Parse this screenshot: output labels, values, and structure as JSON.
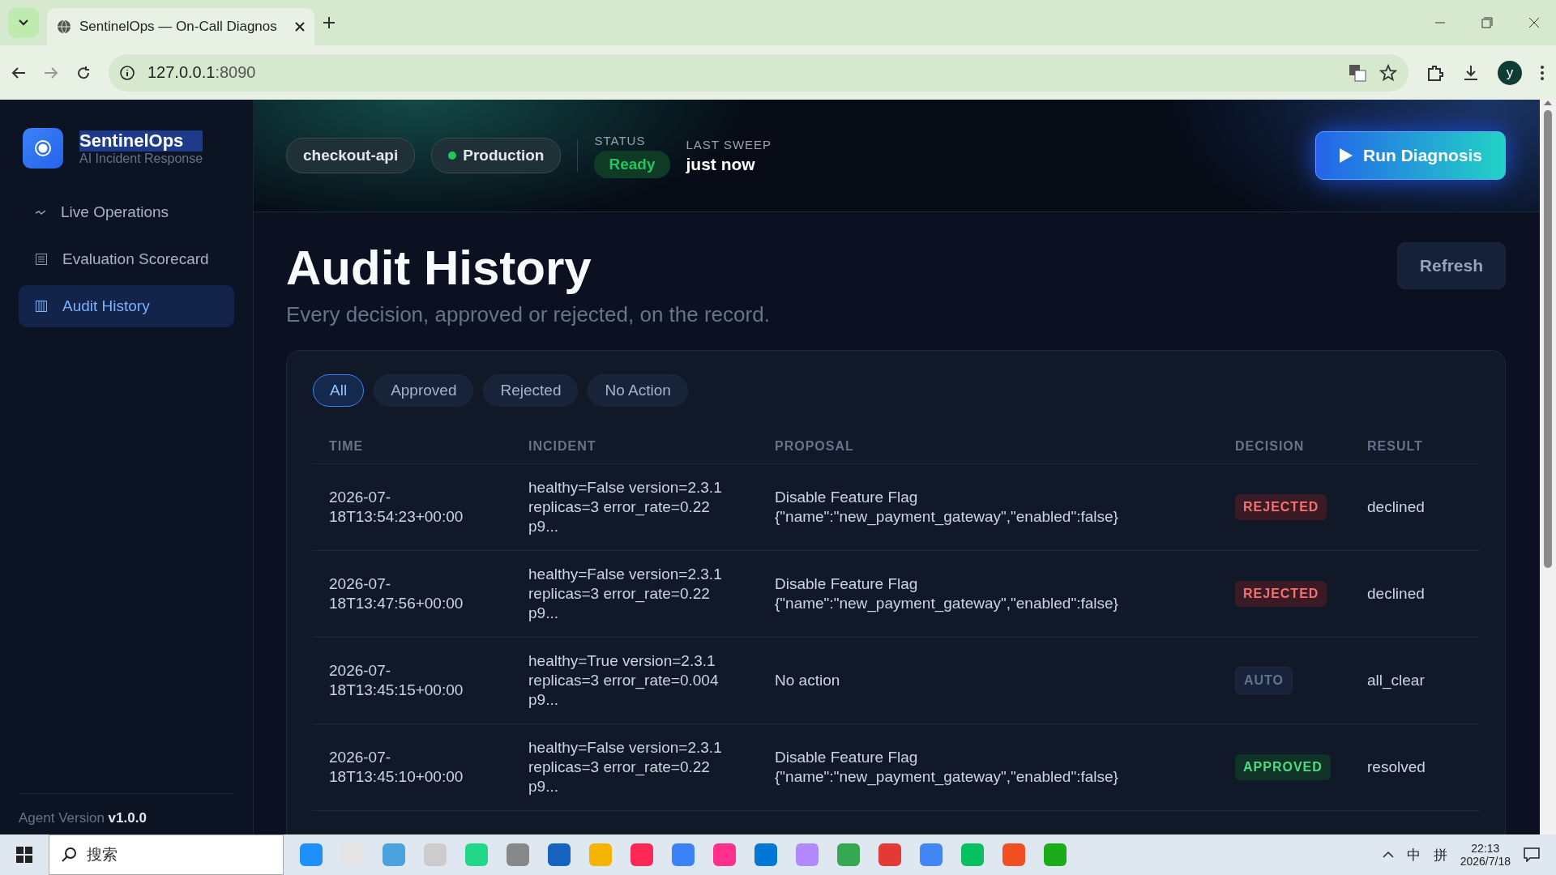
{
  "browser": {
    "tab_title": "SentinelOps — On-Call Diagnos",
    "url_host": "127.0.0.1",
    "url_port": ":8090",
    "profile": "y"
  },
  "sidebar": {
    "brand": "SentinelOps",
    "tagline": "AI Incident Response",
    "items": [
      {
        "label": "Live Operations",
        "kind": "pulse",
        "selected": false
      },
      {
        "label": "Evaluation Scorecard",
        "kind": "list",
        "selected": false
      },
      {
        "label": "Audit History",
        "kind": "columns",
        "selected": true
      }
    ],
    "footer_label": "Agent Version",
    "footer_version": "v1.0.0"
  },
  "header": {
    "service": "checkout-api",
    "environment": {
      "label": "Production",
      "color": "#22c55e"
    },
    "status_label": "STATUS",
    "status": "Ready",
    "sweep_label": "LAST SWEEP",
    "sweep": "just now",
    "run_button": "Run Diagnosis"
  },
  "page": {
    "title": "Audit History",
    "subtitle": "Every decision, approved or rejected, on the record.",
    "refresh": "Refresh"
  },
  "filters": [
    {
      "label": "All",
      "selected": true
    },
    {
      "label": "Approved",
      "selected": false
    },
    {
      "label": "Rejected",
      "selected": false
    },
    {
      "label": "No Action",
      "selected": false
    }
  ],
  "table": {
    "columns": [
      "TIME",
      "INCIDENT",
      "PROPOSAL",
      "DECISION",
      "RESULT"
    ],
    "rows": [
      {
        "time": "2026-07-18T13:54:23+00:00",
        "incident": "healthy=False version=2.3.1 replicas=3 error_rate=0.22 p9...",
        "proposal": "Disable Feature Flag",
        "proposal_args": "{\"name\":\"new_payment_gateway\",\"enabled\":false}",
        "decision": {
          "label": "REJECTED",
          "kind": "rejected"
        },
        "result": "declined"
      },
      {
        "time": "2026-07-18T13:47:56+00:00",
        "incident": "healthy=False version=2.3.1 replicas=3 error_rate=0.22 p9...",
        "proposal": "Disable Feature Flag",
        "proposal_args": "{\"name\":\"new_payment_gateway\",\"enabled\":false}",
        "decision": {
          "label": "REJECTED",
          "kind": "rejected"
        },
        "result": "declined"
      },
      {
        "time": "2026-07-18T13:45:15+00:00",
        "incident": "healthy=True version=2.3.1 replicas=3 error_rate=0.004 p9...",
        "proposal": "No action",
        "decision": {
          "label": "AUTO",
          "kind": "auto"
        },
        "result": "all_clear"
      },
      {
        "time": "2026-07-18T13:45:10+00:00",
        "incident": "healthy=False version=2.3.1 replicas=3 error_rate=0.22 p9...",
        "proposal": "Disable Feature Flag",
        "proposal_args": "{\"name\":\"new_payment_gateway\",\"enabled\":false}",
        "decision": {
          "label": "APPROVED",
          "kind": "approved"
        },
        "result": "resolved"
      }
    ]
  },
  "taskbar": {
    "search_placeholder": "搜索",
    "ime_mode": "中",
    "ime_layout": "拼",
    "time": "22:13",
    "date": "2026/7/18"
  }
}
